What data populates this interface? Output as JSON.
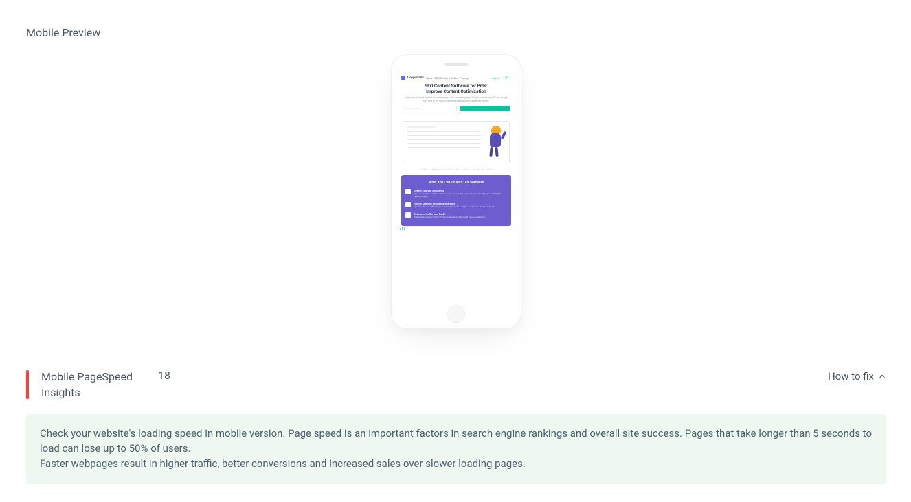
{
  "preview": {
    "heading": "Mobile Preview",
    "site": {
      "brand": "Copywritely",
      "nav_items": [
        "Tools",
        "SEO Content Guide",
        "Pricing"
      ],
      "cta_small": "Sign in",
      "badge": "GO",
      "hero_title_l1": "SEO Content Software for Pros:",
      "hero_title_l2": "Improve Content Optimization",
      "hero_sub": "Make your content perfect for both people and search engines. Check content for SEO issues, get tips how to fix them, rewrite text and publish updated content.",
      "input_placeholder": "Paste your URL",
      "logos": "OWOX  depositphotos  template monster",
      "purple_title": "What You Can Do with Our Software",
      "features": [
        {
          "title": "Detect content problems",
          "desc": "Make competitive and SEO content analysis to identify problems that prevent pages from higher ranking in SERP."
        },
        {
          "title": "Follow specific recommendations",
          "desc": "Specific advice to different content that help to find out how content should be improved."
        },
        {
          "title": "Get more traffic and leads",
          "desc": "High quality unique content will get more organic traffic and more conversions."
        }
      ]
    }
  },
  "insight": {
    "title": "Mobile PageSpeed Insights",
    "score": "18",
    "howto_label": "How to fix",
    "tip_l1": "Check your website's loading speed in mobile version. Page speed is an important factors in search engine rankings and overall site success. Pages that take longer than 5 seconds to load can lose up to 50% of users.",
    "tip_l2": "Faster webpages result in higher traffic, better conversions and increased sales over slower loading pages."
  }
}
